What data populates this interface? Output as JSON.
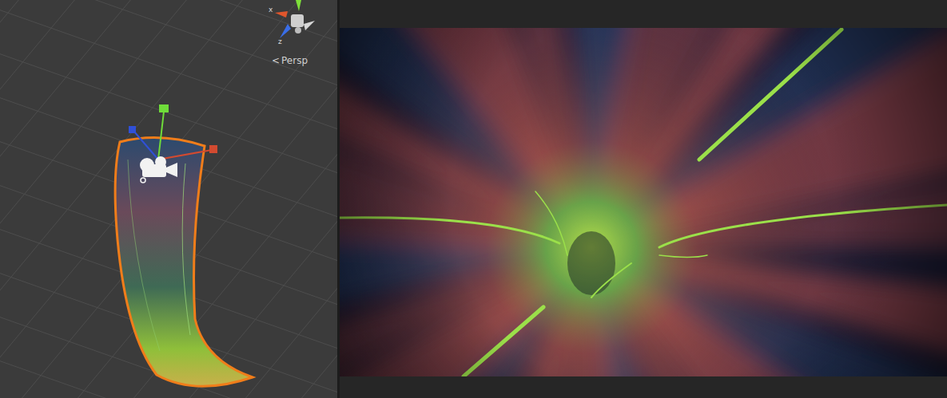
{
  "scene_view": {
    "gizmo": {
      "axes": [
        {
          "label": "x",
          "color": "#e0562c"
        },
        {
          "label": "z",
          "color": "#3a6ee8"
        }
      ],
      "projection_icon": "<",
      "projection": "Persp"
    }
  }
}
